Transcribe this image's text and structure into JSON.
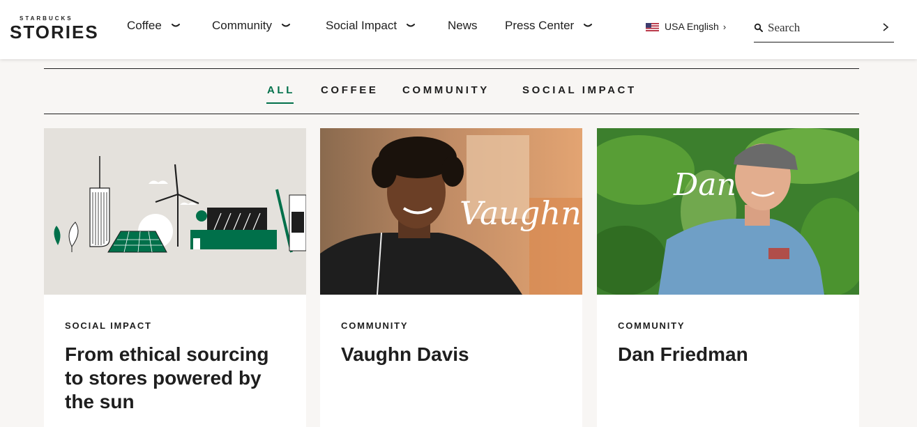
{
  "brand": {
    "top": "STARBUCKS",
    "main": "STORIES"
  },
  "nav": [
    {
      "label": "Coffee",
      "has_dropdown": true
    },
    {
      "label": "Community",
      "has_dropdown": true
    },
    {
      "label": "Social Impact",
      "has_dropdown": true
    },
    {
      "label": "News",
      "has_dropdown": false
    },
    {
      "label": "Press Center",
      "has_dropdown": true
    }
  ],
  "language": {
    "label": "USA English",
    "flag": "us-flag-icon",
    "arrow": "›"
  },
  "search": {
    "placeholder": "Search",
    "value": ""
  },
  "filters": [
    {
      "label": "ALL",
      "active": true
    },
    {
      "label": "COFFEE",
      "active": false
    },
    {
      "label": "COMMUNITY",
      "active": false
    },
    {
      "label": "SOCIAL IMPACT",
      "active": false
    }
  ],
  "cards": [
    {
      "category": "SOCIAL IMPACT",
      "title": "From ethical sourcing to stores powered by the sun",
      "image_text": ""
    },
    {
      "category": "COMMUNITY",
      "title": "Vaughn Davis",
      "image_text": "Vaughn"
    },
    {
      "category": "COMMUNITY",
      "title": "Dan Friedman",
      "image_text": "Dan"
    }
  ],
  "colors": {
    "accent": "#00704a",
    "page_bg": "#f8f6f4",
    "text": "#1e1e1e",
    "illustration_bg": "#e4e1dc"
  }
}
